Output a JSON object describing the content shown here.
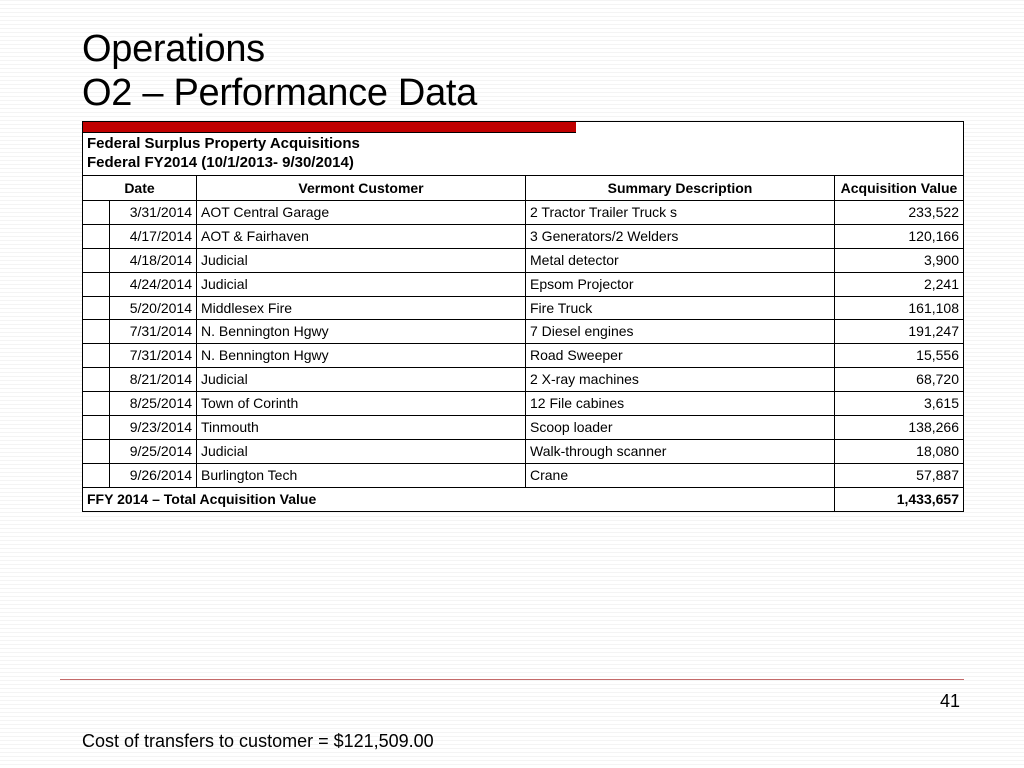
{
  "title_line1": "Operations",
  "title_line2": "O2 – Performance Data",
  "table_header_title": "Federal Surplus Property Acquisitions",
  "table_header_sub": "Federal FY2014 (10/1/2013- 9/30/2014)",
  "columns": {
    "date": "Date",
    "customer": "Vermont Customer",
    "description": "Summary Description",
    "value": "Acquisition Value"
  },
  "rows": [
    {
      "date": "3/31/2014",
      "customer": "AOT Central Garage",
      "description": "2 Tractor Trailer Truck s",
      "value": "233,522"
    },
    {
      "date": "4/17/2014",
      "customer": "AOT & Fairhaven",
      "description": "3 Generators/2 Welders",
      "value": "120,166"
    },
    {
      "date": "4/18/2014",
      "customer": "Judicial",
      "description": "Metal detector",
      "value": "3,900"
    },
    {
      "date": "4/24/2014",
      "customer": "Judicial",
      "description": "Epsom Projector",
      "value": "2,241"
    },
    {
      "date": "5/20/2014",
      "customer": "Middlesex Fire",
      "description": "Fire Truck",
      "value": "161,108"
    },
    {
      "date": "7/31/2014",
      "customer": "N. Bennington Hgwy",
      "description": "7 Diesel engines",
      "value": "191,247"
    },
    {
      "date": "7/31/2014",
      "customer": "N. Bennington Hgwy",
      "description": "Road Sweeper",
      "value": "15,556"
    },
    {
      "date": "8/21/2014",
      "customer": "Judicial",
      "description": "2 X-ray machines",
      "value": "68,720"
    },
    {
      "date": "8/25/2014",
      "customer": "Town of Corinth",
      "description": "12 File cabines",
      "value": "3,615"
    },
    {
      "date": "9/23/2014",
      "customer": "Tinmouth",
      "description": "Scoop loader",
      "value": "138,266"
    },
    {
      "date": "9/25/2014",
      "customer": "Judicial",
      "description": "Walk-through scanner",
      "value": "18,080"
    },
    {
      "date": "9/26/2014",
      "customer": "Burlington Tech",
      "description": "Crane",
      "value": "57,887"
    }
  ],
  "total_label": "FFY 2014 – Total Acquisition Value",
  "total_value": "1,433,657",
  "page_number": "41",
  "footnote": "Cost of transfers to customer = $121,509.00"
}
